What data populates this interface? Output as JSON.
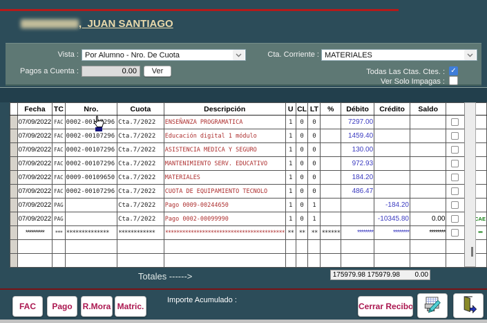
{
  "header": {
    "name": ",  JUAN SANTIAGO"
  },
  "filters": {
    "vista_label": "Vista :",
    "vista_value": "Por Alumno - Nro. De Cuota",
    "pagos_label": "Pagos a Cuenta :",
    "pagos_value": "0.00",
    "ver_button": "Ver",
    "cta_label": "Cta. Corriente :",
    "cta_value": "MATERIALES",
    "todas_label": "Todas Las Ctas. Ctes. :",
    "todas_checked": true,
    "impagas_label": "Ver Solo Impagas :",
    "impagas_checked": false
  },
  "table": {
    "headers": [
      "Fecha",
      "TC",
      "Nro.",
      "Cuota",
      "Descripción",
      "U",
      "CL",
      "LT",
      "%",
      "Débito",
      "Crédito",
      "Saldo"
    ],
    "rows": [
      {
        "fecha": "07/09/2022",
        "tc": "FAC",
        "nro": "0002-00107296",
        "cuota": "Cta.7/2022",
        "desc": "ENSEÑANZA PROGRAMATICA",
        "u": "1",
        "cl": "0",
        "lt": "0",
        "pct": "",
        "debito": "7297.00",
        "credito": "",
        "saldo": "",
        "flag": "",
        "extra": "",
        "cb": true,
        "ast": false
      },
      {
        "fecha": "07/09/2022",
        "tc": "FAC",
        "nro": "0002-00107296",
        "cuota": "Cta.7/2022",
        "desc": "Educación digital 1 módulo",
        "u": "1",
        "cl": "0",
        "lt": "0",
        "pct": "",
        "debito": "1459.40",
        "credito": "",
        "saldo": "",
        "flag": "",
        "extra": "",
        "cb": true,
        "ast": false
      },
      {
        "fecha": "07/09/2022",
        "tc": "FAC",
        "nro": "0002-00107296",
        "cuota": "Cta.7/2022",
        "desc": "ASISTENCIA MEDICA Y SEGURO",
        "u": "1",
        "cl": "0",
        "lt": "0",
        "pct": "",
        "debito": "130.00",
        "credito": "",
        "saldo": "",
        "flag": "",
        "extra": "",
        "cb": true,
        "ast": false
      },
      {
        "fecha": "07/09/2022",
        "tc": "FAC",
        "nro": "0002-00107296",
        "cuota": "Cta.7/2022",
        "desc": "MANTENIMIENTO SERV. EDUCATIVO",
        "u": "1",
        "cl": "0",
        "lt": "0",
        "pct": "",
        "debito": "972.93",
        "credito": "",
        "saldo": "",
        "flag": "",
        "extra": "",
        "cb": true,
        "ast": false
      },
      {
        "fecha": "07/09/2022",
        "tc": "FAC",
        "nro": "0009-00109650",
        "cuota": "Cta.7/2022",
        "desc": "MATERIALES",
        "u": "1",
        "cl": "0",
        "lt": "0",
        "pct": "",
        "debito": "184.20",
        "credito": "",
        "saldo": "",
        "flag": "",
        "extra": "",
        "cb": true,
        "ast": false
      },
      {
        "fecha": "07/09/2022",
        "tc": "FAC",
        "nro": "0002-00107296",
        "cuota": "Cta.7/2022",
        "desc": "CUOTA DE EQUIPAMIENTO TECNOLO",
        "u": "1",
        "cl": "0",
        "lt": "0",
        "pct": "",
        "debito": "486.47",
        "credito": "",
        "saldo": "",
        "flag": "",
        "extra": "",
        "cb": true,
        "ast": false
      },
      {
        "fecha": "07/09/2022",
        "tc": "PAG",
        "nro": "",
        "cuota": "Cta.7/2022",
        "desc": "Pago 0009-00244650",
        "u": "1",
        "cl": "0",
        "lt": "1",
        "pct": "",
        "debito": "",
        "credito": "-184.20",
        "saldo": "",
        "flag": "",
        "extra": "",
        "cb": true,
        "ast": false
      },
      {
        "fecha": "07/09/2022",
        "tc": "PAG",
        "nro": "",
        "cuota": "Cta.7/2022",
        "desc": "Pago 0002-00099990",
        "u": "1",
        "cl": "0",
        "lt": "1",
        "pct": "",
        "debito": "",
        "credito": "-10345.80",
        "saldo": "0.00",
        "flag": "",
        "extra": "CAE",
        "cb": true,
        "ast": false
      },
      {
        "fecha": "**********",
        "tc": "***",
        "nro": "**************",
        "cuota": "************",
        "desc": "******************************************",
        "u": "**",
        "cl": "**",
        "lt": "**",
        "pct": "******",
        "debito": "********",
        "credito": "********",
        "saldo": "********",
        "flag": "*",
        "extra": "***",
        "cb": true,
        "ast": true
      },
      {
        "fecha": "",
        "tc": "",
        "nro": "",
        "cuota": "",
        "desc": "",
        "u": "",
        "cl": "",
        "lt": "",
        "pct": "",
        "debito": "",
        "credito": "",
        "saldo": "",
        "flag": "",
        "extra": "",
        "cb": false,
        "ast": false
      },
      {
        "fecha": "",
        "tc": "",
        "nro": "",
        "cuota": "",
        "desc": "",
        "u": "",
        "cl": "",
        "lt": "",
        "pct": "",
        "debito": "",
        "credito": "",
        "saldo": "",
        "flag": "",
        "extra": "",
        "cb": false,
        "ast": false
      }
    ]
  },
  "totals": {
    "label": "Totales ------>",
    "debito": "175979.98",
    "credito": "175979.98",
    "saldo": "0.00"
  },
  "footer": {
    "buttons": [
      "FAC",
      "Pago",
      "R.Mora",
      "Matric."
    ],
    "importe_label": "Importe Acumulado :",
    "cerrar_button": "Cerrar Recibo"
  },
  "colors": {
    "background": "#2c4c59",
    "panel": "#5e7874",
    "top_line_red": "#b61a1a",
    "bottom_line_red": "#7a1216",
    "title_cream": "#e9d9ab",
    "button_text": "#ab1750",
    "debit_blue": "#3a3ac0",
    "description_red": "#ad2f2f",
    "cae_green": "#168016",
    "checkbox_blue": "#3f7dd8"
  }
}
